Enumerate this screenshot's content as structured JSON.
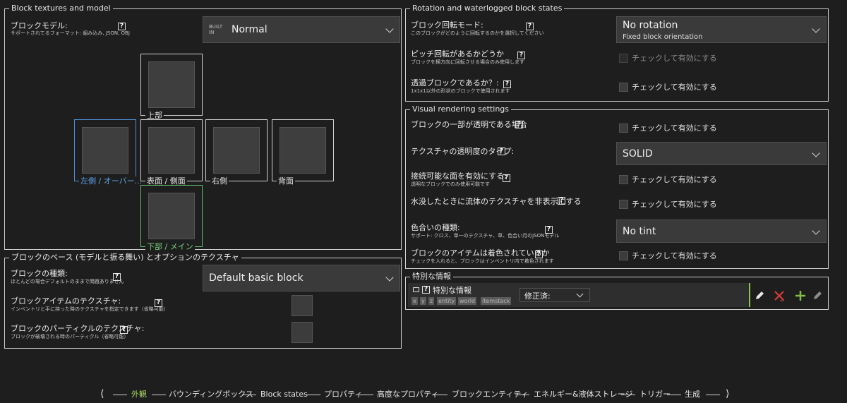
{
  "left": {
    "model_panel": {
      "title": "Block textures and model",
      "model_label": "ブロックモデル:",
      "model_sub": "サポートされてるフォーマット: 組み込み, JSON, OBJ",
      "model_value": "Normal",
      "builtin_badge": "BUILT IN",
      "faces": {
        "top": "上部",
        "left": "左側 / オーバー...",
        "front": "表面 / 側面",
        "right": "右側",
        "back": "背面",
        "bottom": "下部 / メイン"
      }
    },
    "base_panel": {
      "title": "ブロックのベース (モデルと振る舞い) とオプションのテクスチャ",
      "type_label": "ブロックの種類:",
      "type_sub": "ほとんどの場合デフォルトのままで問題ありません",
      "type_value": "Default basic block",
      "item_tex_label": "ブロックアイテムのテクスチャ:",
      "item_tex_sub": "インベントリと手に持った時のテクスチャを指定できます（省略可能）",
      "particle_label": "ブロックのパーティクルのテクスチャ:",
      "particle_sub": "ブロックが破壊される時のパーティクル（省略可能）"
    }
  },
  "right": {
    "rotation_panel": {
      "title": "Rotation and waterlogged block states",
      "rot_label": "ブロック回転モード:",
      "rot_sub": "このブロックがどのように回転するのかを選択してください",
      "rot_value": "No rotation",
      "rot_value_sub": "Fixed block orientation",
      "pitch_label": "ピッチ回転があるかどうか",
      "pitch_sub": "ブロックを横方向に回転させる場合のみ使用します",
      "pitch_check": "チェックして有効にする",
      "trans_label": "透過ブロックであるか？:",
      "trans_sub": "1x1x1以外の形状のブロックで使用されます",
      "trans_check": "チェックして有効にする"
    },
    "visual_panel": {
      "title": "Visual rendering settings",
      "partial_label": "ブロックの一部が透明である場合",
      "partial_check": "チェックして有効にする",
      "transp_label": "テクスチャの透明度のタイプ:",
      "transp_value": "SOLID",
      "connect_label": "接続可能な面を有効にする:",
      "connect_sub": "透明なブロックでのみ使用可能です",
      "connect_check": "チェックして有効にする",
      "submerged_label": "水没したときに流体のテクスチャを非表示にする",
      "submerged_check": "チェックして有効にする",
      "tint_label": "色合いの種類:",
      "tint_sub": "サポート: クロス、単一のテクスチャ、草、色合い月のJSONモデル",
      "tint_value": "No tint",
      "item_tinted_label": "ブロックのアイテムは着色されているか",
      "item_tinted_sub": "チェックを入れると、ブロックはインベントリ内で着色されます",
      "item_tinted_check": "チェックして有効にする"
    },
    "special_panel": {
      "title": "特別な情報",
      "label": "特別な情報",
      "tags": [
        "x",
        "y",
        "z",
        "entity",
        "world",
        "itemstack"
      ],
      "modifier_value": "修正済:"
    }
  },
  "nav": {
    "items": [
      "外観",
      "バウンディングボックス",
      "Block states",
      "プロパティ",
      "高度なプロパティ",
      "ブロックエンティティ",
      "エネルギー&液体ストレージ",
      "トリガー",
      "生成"
    ],
    "accent": "#a6d35f"
  }
}
